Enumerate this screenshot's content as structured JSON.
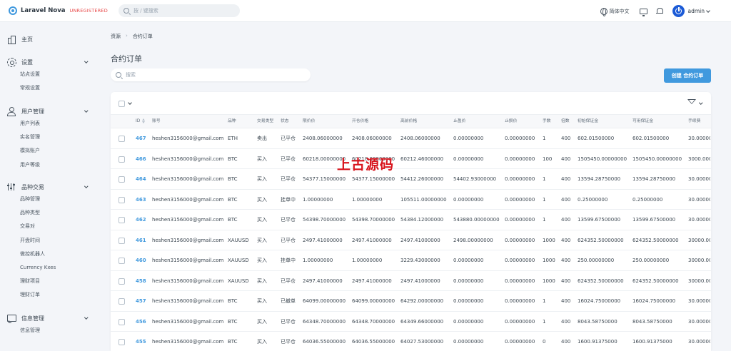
{
  "brand": {
    "name": "Laravel Nova",
    "tag": "UNREGISTERED"
  },
  "global_search": {
    "placeholder": "按 / 键搜索"
  },
  "topbar": {
    "language": "简体中文",
    "user": "admin"
  },
  "sidebar": {
    "home": "主页",
    "groups": [
      {
        "label": "设置",
        "icon": "gear-icon",
        "items": [
          "站点设置",
          "常规设置"
        ]
      },
      {
        "label": "用户管理",
        "icon": "users-icon",
        "items": [
          "用户列表",
          "实名管理",
          "模拟账户",
          "用户等级"
        ]
      },
      {
        "label": "品种交易",
        "icon": "sliders-icon",
        "items": [
          "品种管理",
          "品种类型",
          "交易对",
          "开盘时间",
          "做控机器人",
          "Currency Kxes",
          "理财项目",
          "理财订单"
        ]
      },
      {
        "label": "信息管理",
        "icon": "chat-icon",
        "items": [
          "信息管理"
        ]
      }
    ]
  },
  "breadcrumb": {
    "root": "资源",
    "current": "合约订单"
  },
  "page": {
    "title": "合约订单",
    "search_placeholder": "搜索",
    "create_label": "创建 合约订单"
  },
  "table": {
    "columns": [
      "ID",
      "账号",
      "品种",
      "交易类型",
      "状态",
      "限价价",
      "开仓价格",
      "高前价格",
      "止盈价",
      "止损价",
      "手数",
      "倍数",
      "初始保证金",
      "可用保证金",
      "手续费"
    ],
    "rows": [
      [
        "467",
        "heshen3156000@gmail.com",
        "ETH",
        "卖出",
        "已平仓",
        "2408.06000000",
        "2408.06000000",
        "2408.06000000",
        "0.00000000",
        "0.00000000",
        "1",
        "400",
        "602.01500000",
        "602.01500000",
        "30.00000"
      ],
      [
        "466",
        "heshen3156000@gmail.com",
        "BTC",
        "买入",
        "已平仓",
        "60218.00000000",
        "60218.00000000",
        "60212.46000000",
        "0.00000000",
        "0.00000000",
        "100",
        "400",
        "1505450.00000000",
        "1505450.00000000",
        "3000.000"
      ],
      [
        "464",
        "heshen3156000@gmail.com",
        "BTC",
        "买入",
        "已平仓",
        "54377.15000000",
        "54377.15000000",
        "54412.26000000",
        "54402.93000000",
        "0.00000000",
        "1",
        "400",
        "13594.28750000",
        "13594.28750000",
        "30.00000"
      ],
      [
        "463",
        "heshen3156000@gmail.com",
        "BTC",
        "买入",
        "挂单中",
        "1.00000000",
        "1.00000000",
        "105511.00000000",
        "0.00000000",
        "0.00000000",
        "1",
        "400",
        "0.25000000",
        "0.25000000",
        "30.00000"
      ],
      [
        "462",
        "heshen3156000@gmail.com",
        "BTC",
        "买入",
        "已平仓",
        "54398.70000000",
        "54398.70000000",
        "54384.12000000",
        "543880.00000000",
        "0.00000000",
        "1",
        "400",
        "13599.67500000",
        "13599.67500000",
        "30.00000"
      ],
      [
        "461",
        "heshen3156000@gmail.com",
        "XAUUSD",
        "买入",
        "已平仓",
        "2497.41000000",
        "2497.41000000",
        "2497.41000000",
        "2498.00000000",
        "0.00000000",
        "1000",
        "400",
        "624352.50000000",
        "624352.50000000",
        "30000.00"
      ],
      [
        "460",
        "heshen3156000@gmail.com",
        "XAUUSD",
        "买入",
        "挂单中",
        "1.00000000",
        "1.00000000",
        "3229.43000000",
        "0.00000000",
        "0.00000000",
        "1000",
        "400",
        "250.00000000",
        "250.00000000",
        "30000.00"
      ],
      [
        "458",
        "heshen3156000@gmail.com",
        "XAUUSD",
        "买入",
        "已平仓",
        "2497.41000000",
        "2497.41000000",
        "2497.41000000",
        "0.00000000",
        "0.00000000",
        "1000",
        "400",
        "624352.50000000",
        "624352.50000000",
        "30000.00"
      ],
      [
        "457",
        "heshen3156000@gmail.com",
        "BTC",
        "买入",
        "已撤单",
        "64099.00000000",
        "64099.00000000",
        "64292.00000000",
        "0.00000000",
        "0.00000000",
        "1",
        "400",
        "16024.75000000",
        "16024.75000000",
        "30.00000"
      ],
      [
        "456",
        "heshen3156000@gmail.com",
        "BTC",
        "买入",
        "已平仓",
        "64348.70000000",
        "64348.70000000",
        "64349.66000000",
        "0.00000000",
        "0.00000000",
        "1",
        "400",
        "8043.58750000",
        "8043.58750000",
        "30.00000"
      ],
      [
        "455",
        "heshen3156000@gmail.com",
        "BTC",
        "买入",
        "已平仓",
        "64036.55000000",
        "64036.55000000",
        "64027.53000000",
        "0.00000000",
        "0.00000000",
        "0",
        "400",
        "1600.91375000",
        "1600.91375000",
        "30.00000"
      ]
    ]
  },
  "watermark": "上古源码",
  "colors": {
    "accent": "#4099de",
    "brand_tag": "#e74444",
    "avatar": "#1c5bd6",
    "watermark": "#d8141c"
  }
}
